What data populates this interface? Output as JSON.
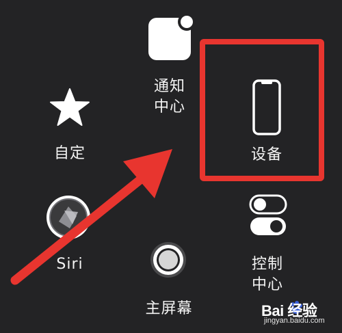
{
  "menu": {
    "notification_center_label": "通知\n中心",
    "custom_label": "自定",
    "device_label": "设备",
    "siri_label": "Siri",
    "home_label": "主屏幕",
    "control_center_label": "控制\n中心"
  },
  "icons": {
    "notification_center": "notification-square-icon",
    "custom": "star-icon",
    "device": "iphone-icon",
    "siri": "siri-orb-icon",
    "home": "home-button-icon",
    "control_center": "toggle-switches-icon"
  },
  "annotations": {
    "highlight_color": "#e8352f",
    "arrow_color": "#e8352f"
  },
  "watermark": {
    "logo_text": "Bai 经验",
    "url": "jingyan.baidu.com"
  }
}
